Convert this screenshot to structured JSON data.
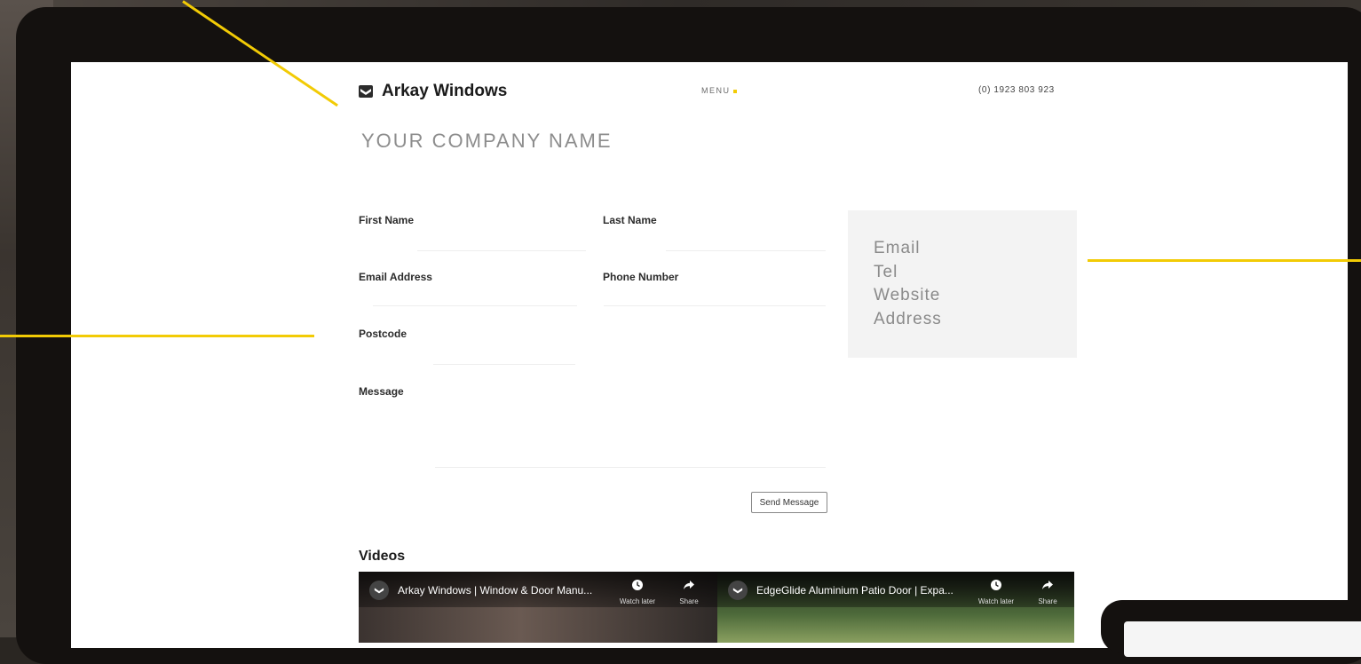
{
  "header": {
    "brand": "Arkay Windows",
    "menu_label": "MENU",
    "phone": "(0) 1923 803 923",
    "company_name": "YOUR COMPANY NAME"
  },
  "form": {
    "first_name_label": "First Name",
    "last_name_label": "Last Name",
    "email_label": "Email Address",
    "phone_label": "Phone Number",
    "postcode_label": "Postcode",
    "message_label": "Message",
    "send_label": "Send Message"
  },
  "info_box": {
    "lines": [
      "Email",
      "Tel",
      "Website",
      "Address"
    ]
  },
  "videos": {
    "title": "Videos",
    "items": [
      {
        "title": "Arkay Windows | Window & Door Manu...",
        "watch_later": "Watch later",
        "share": "Share"
      },
      {
        "title": "EdgeGlide Aluminium Patio Door | Expa...",
        "watch_later": "Watch later",
        "share": "Share"
      }
    ]
  },
  "colors": {
    "accent": "#f2cb05",
    "bezel": "#14110f",
    "info_bg": "#f3f3f3"
  }
}
